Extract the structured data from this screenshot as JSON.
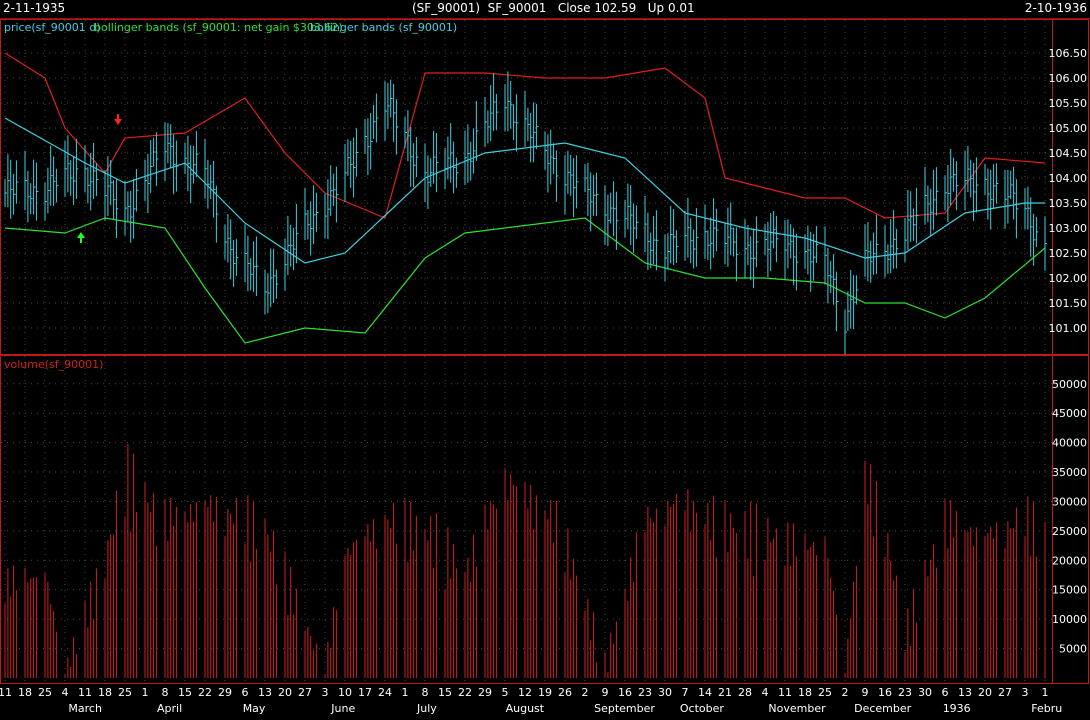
{
  "header": {
    "date_start": "2-11-1935",
    "title": "(SF_90001)  SF_90001   Close 102.59   Up 0.01",
    "date_end": "2-10-1936"
  },
  "colors": {
    "background": "#000000",
    "panel_border": "#c01818",
    "grid": "#8a8a8a",
    "price": "#3cd0e0",
    "middle_band": "#3cd0e0",
    "upper_band": "#e02020",
    "lower_band": "#30e030",
    "volume": "#d02020",
    "sell_arrow": "#ff2020",
    "buy_arrow": "#20ff20"
  },
  "price_panel": {
    "legend_price": "price(sf_90001 d)",
    "legend_bb_gain": "bollinger bands (sf_90001: net gain $303.62)",
    "legend_bb": "bollinger bands (sf_90001)"
  },
  "volume_panel": {
    "legend": "volume(sf_90001)"
  },
  "x_axis": {
    "day_labels": [
      "11",
      "18",
      "25",
      "4",
      "11",
      "18",
      "25",
      "1",
      "8",
      "15",
      "22",
      "29",
      "6",
      "13",
      "20",
      "27",
      "3",
      "10",
      "17",
      "24",
      "1",
      "8",
      "15",
      "22",
      "29",
      "5",
      "12",
      "19",
      "26",
      "2",
      "9",
      "16",
      "23",
      "30",
      "7",
      "14",
      "21",
      "28",
      "4",
      "11",
      "18",
      "25",
      "2",
      "9",
      "16",
      "23",
      "30",
      "6",
      "13",
      "20",
      "27",
      "3",
      "1"
    ],
    "month_labels": [
      "March",
      "April",
      "May",
      "June",
      "July",
      "August",
      "September",
      "October",
      "November",
      "December",
      "1936",
      "Febru"
    ]
  },
  "chart_data": [
    {
      "type": "line",
      "title": "",
      "x_start": "1935-02-11",
      "x_end": "1936-02-10",
      "ylim": [
        100.6,
        106.8
      ],
      "yticks": [
        101.0,
        101.5,
        102.0,
        102.5,
        103.0,
        103.5,
        104.0,
        104.5,
        105.0,
        105.5,
        106.0,
        106.5
      ],
      "grid": true,
      "series": [
        {
          "name": "price",
          "x": [
            "1935-02-11",
            "1935-02-25",
            "1935-03-11",
            "1935-03-25",
            "1935-04-08",
            "1935-04-22",
            "1935-05-01",
            "1935-05-13",
            "1935-05-27",
            "1935-06-10",
            "1935-06-24",
            "1935-07-08",
            "1935-07-22",
            "1935-08-05",
            "1935-08-19",
            "1935-09-02",
            "1935-09-16",
            "1935-09-30",
            "1935-10-14",
            "1935-10-28",
            "1935-11-11",
            "1935-11-25",
            "1935-12-02",
            "1935-12-09",
            "1935-12-23",
            "1936-01-06",
            "1936-01-20",
            "1936-02-03",
            "1936-02-10"
          ],
          "values": [
            103.7,
            103.8,
            104.2,
            103.3,
            104.6,
            104.1,
            102.6,
            101.8,
            103.0,
            104.0,
            105.5,
            104.1,
            104.4,
            105.6,
            104.5,
            103.7,
            103.2,
            102.6,
            102.9,
            102.6,
            102.7,
            102.3,
            101.2,
            102.3,
            102.9,
            103.9,
            103.9,
            103.4,
            102.59
          ]
        },
        {
          "name": "upper band",
          "x": [
            "1935-02-11",
            "1935-02-25",
            "1935-03-04",
            "1935-03-18",
            "1935-03-25",
            "1935-04-15",
            "1935-05-06",
            "1935-05-20",
            "1935-06-03",
            "1935-06-24",
            "1935-07-08",
            "1935-07-29",
            "1935-08-19",
            "1935-09-09",
            "1935-09-30",
            "1935-10-14",
            "1935-10-21",
            "1935-11-18",
            "1935-12-02",
            "1935-12-16",
            "1936-01-06",
            "1936-01-20",
            "1936-02-10"
          ],
          "values": [
            106.5,
            106.0,
            105.0,
            104.1,
            104.8,
            104.9,
            105.6,
            104.5,
            103.7,
            103.2,
            106.1,
            106.1,
            106.0,
            106.0,
            106.2,
            105.6,
            104.0,
            103.6,
            103.6,
            103.2,
            103.3,
            104.4,
            104.3
          ]
        },
        {
          "name": "middle band",
          "x": [
            "1935-02-11",
            "1935-03-11",
            "1935-03-25",
            "1935-04-15",
            "1935-05-06",
            "1935-05-27",
            "1935-06-10",
            "1935-07-08",
            "1935-07-29",
            "1935-08-26",
            "1935-09-16",
            "1935-10-07",
            "1935-10-28",
            "1935-11-18",
            "1935-12-09",
            "1935-12-23",
            "1936-01-13",
            "1936-02-03",
            "1936-02-10"
          ],
          "values": [
            105.2,
            104.3,
            103.9,
            104.3,
            103.1,
            102.3,
            102.5,
            104.0,
            104.5,
            104.7,
            104.4,
            103.3,
            103.0,
            102.8,
            102.4,
            102.5,
            103.3,
            103.5,
            103.5
          ]
        },
        {
          "name": "lower band",
          "x": [
            "1935-02-11",
            "1935-03-04",
            "1935-03-18",
            "1935-04-08",
            "1935-04-22",
            "1935-05-06",
            "1935-05-27",
            "1935-06-17",
            "1935-07-08",
            "1935-07-22",
            "1935-08-19",
            "1935-09-02",
            "1935-09-23",
            "1935-10-14",
            "1935-11-04",
            "1935-11-25",
            "1935-12-09",
            "1935-12-23",
            "1936-01-06",
            "1936-01-20",
            "1936-02-10"
          ],
          "values": [
            103.0,
            102.9,
            103.2,
            103.0,
            101.8,
            100.7,
            101.0,
            100.9,
            102.4,
            102.9,
            103.1,
            103.2,
            102.3,
            102.0,
            102.0,
            101.9,
            101.5,
            101.5,
            101.2,
            101.6,
            102.6
          ]
        }
      ]
    },
    {
      "type": "bar",
      "title": "",
      "ylim": [
        0,
        52000
      ],
      "yticks": [
        5000,
        10000,
        15000,
        20000,
        25000,
        30000,
        35000,
        40000,
        45000,
        50000
      ],
      "grid": true,
      "series": [
        {
          "name": "volume",
          "x": [
            "1935-02-11",
            "1935-02-25",
            "1935-03-04",
            "1935-03-18",
            "1935-03-25",
            "1935-04-08",
            "1935-04-22",
            "1935-05-13",
            "1935-06-03",
            "1935-06-10",
            "1935-06-24",
            "1935-07-08",
            "1935-07-22",
            "1935-08-05",
            "1935-08-19",
            "1935-08-26",
            "1935-09-09",
            "1935-09-23",
            "1935-10-07",
            "1935-10-14",
            "1935-10-28",
            "1935-11-18",
            "1935-11-25",
            "1935-12-02",
            "1935-12-09",
            "1935-12-16",
            "1935-12-23",
            "1936-01-06",
            "1936-01-20",
            "1936-02-03",
            "1936-02-10"
          ],
          "values": [
            18000,
            20000,
            1000,
            22000,
            38000,
            30000,
            33000,
            28000,
            1500,
            24000,
            30000,
            28000,
            20000,
            38000,
            32000,
            26000,
            2000,
            30000,
            34000,
            30000,
            28000,
            25000,
            26000,
            2000,
            38000,
            28000,
            8000,
            30000,
            27000,
            30000,
            27000
          ]
        }
      ]
    }
  ]
}
